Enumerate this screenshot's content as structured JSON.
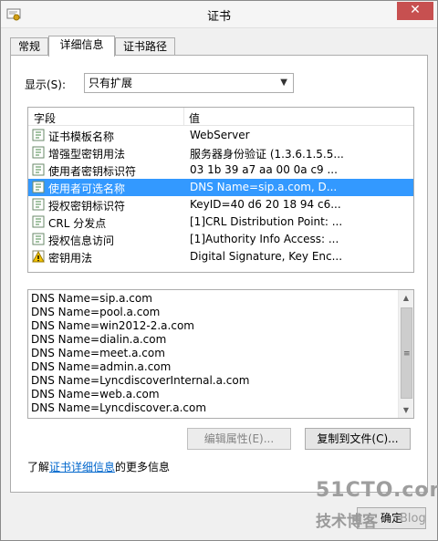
{
  "window": {
    "title": "证书",
    "close_label": "✕"
  },
  "tabs": [
    {
      "label": "常规"
    },
    {
      "label": "详细信息"
    },
    {
      "label": "证书路径"
    }
  ],
  "show": {
    "label": "显示(S):",
    "selected": "只有扩展"
  },
  "list": {
    "headers": {
      "field": "字段",
      "value": "值"
    },
    "rows": [
      {
        "name": "证书模板名称",
        "value": "WebServer",
        "icon": "extension-icon"
      },
      {
        "name": "增强型密钥用法",
        "value": "服务器身份验证 (1.3.6.1.5.5...",
        "icon": "extension-icon"
      },
      {
        "name": "使用者密钥标识符",
        "value": "03 1b 39 a7 aa 00 0a c9 ...",
        "icon": "extension-icon"
      },
      {
        "name": "使用者可选名称",
        "value": "DNS Name=sip.a.com, D...",
        "icon": "extension-icon",
        "selected": true
      },
      {
        "name": "授权密钥标识符",
        "value": "KeyID=40 d6 20 18 94 c6...",
        "icon": "extension-icon"
      },
      {
        "name": "CRL 分发点",
        "value": "[1]CRL Distribution Point: ...",
        "icon": "extension-icon"
      },
      {
        "name": "授权信息访问",
        "value": "[1]Authority Info Access: ...",
        "icon": "extension-icon"
      },
      {
        "name": "密钥用法",
        "value": "Digital Signature, Key Enc...",
        "icon": "warning-extension-icon"
      }
    ]
  },
  "details": [
    "DNS Name=sip.a.com",
    "DNS Name=pool.a.com",
    "DNS Name=win2012-2.a.com",
    "DNS Name=dialin.a.com",
    "DNS Name=meet.a.com",
    "DNS Name=admin.a.com",
    "DNS Name=LyncdiscoverInternal.a.com",
    "DNS Name=web.a.com",
    "DNS Name=Lyncdiscover.a.com"
  ],
  "buttons": {
    "edit_properties": "编辑属性(E)...",
    "copy_to_file": "复制到文件(C)...",
    "ok": "确定"
  },
  "more_info": {
    "prefix": "了解",
    "link": "证书详细信息",
    "suffix": "的更多信息"
  },
  "watermark": {
    "top": "51CTO.com",
    "bottom": "技术博客",
    "blog": "Blog"
  },
  "colors": {
    "selection": "#3399ff",
    "link": "#0066cc",
    "close": "#c75050"
  }
}
